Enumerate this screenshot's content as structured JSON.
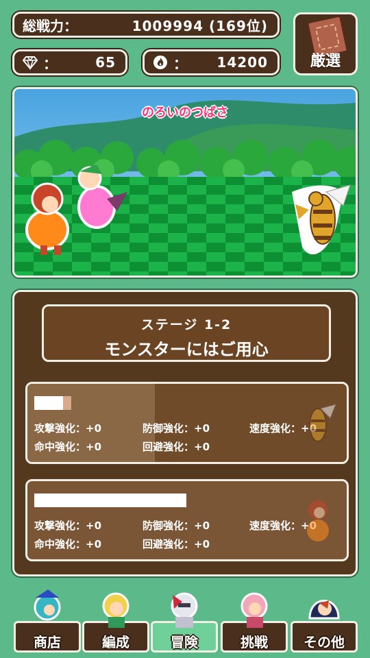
{
  "header": {
    "power_label": "総戦力：",
    "power_value": "1009994 (169位)",
    "gems_colon": "：",
    "gems_value": "65",
    "fire_colon": "：",
    "fire_value": "14200",
    "select_button": "厳選"
  },
  "battle": {
    "skill_name": "のろいのつばさ"
  },
  "stage": {
    "number": "ステージ 1-2",
    "name": "モンスターにはご用心",
    "enemies": [
      {
        "stats": [
          "攻撃強化：+0",
          "防御強化：+0",
          "速度強化：+0",
          "命中強化：+0",
          "回避強化：+0"
        ]
      },
      {
        "stats": [
          "攻撃強化：+0",
          "防御強化：+0",
          "速度強化：+0",
          "命中強化：+0",
          "回避強化：+0"
        ]
      }
    ]
  },
  "nav": [
    {
      "label": "商店"
    },
    {
      "label": "編成"
    },
    {
      "label": "冒険"
    },
    {
      "label": "挑戦"
    },
    {
      "label": "その他"
    }
  ],
  "colors": {
    "background": "#5bb98a",
    "panel": "#4a2f1c",
    "skill_text": "#ff2f7a",
    "active_tab": "#6fd09a"
  },
  "icons": [
    "diamond-icon",
    "flame-icon",
    "stone-tablet-icon"
  ]
}
